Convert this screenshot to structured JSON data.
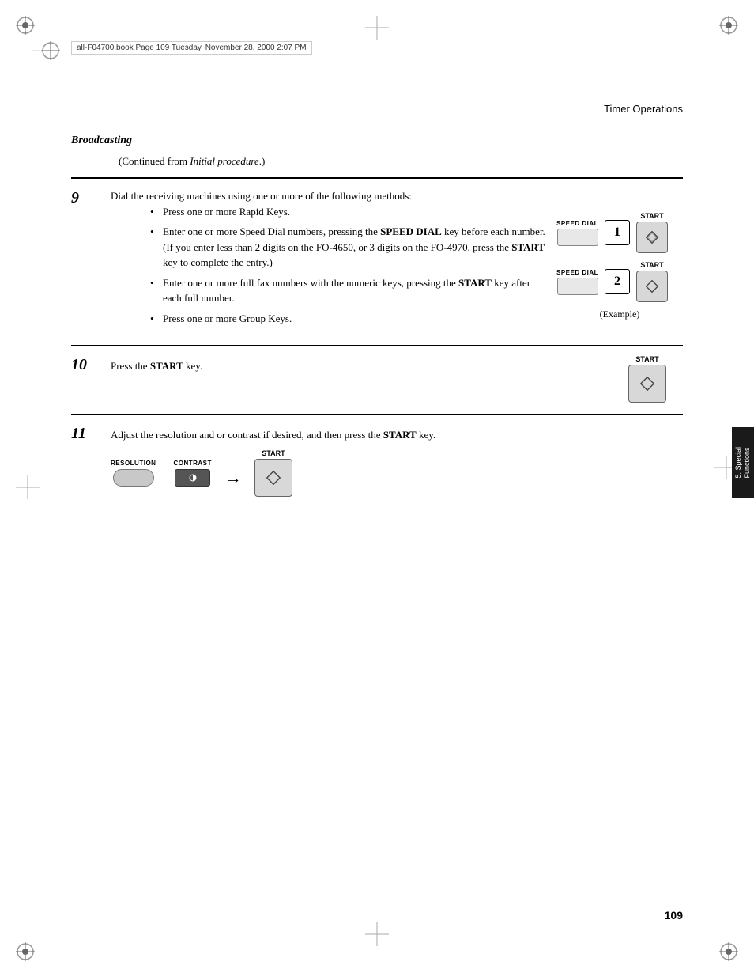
{
  "page": {
    "title": "Timer Operations",
    "page_number": "109",
    "file_header": "all-F04700.book  Page 109  Tuesday, November 28, 2000  2:07 PM"
  },
  "section": {
    "heading": "Broadcasting",
    "continued_text": "(Continued from ",
    "continued_italic": "Initial procedure",
    "continued_end": ".)"
  },
  "steps": {
    "step9": {
      "number": "9",
      "text": "Dial the receiving machines using one or more of the following methods:",
      "bullets": [
        "Press one or more Rapid Keys.",
        "Enter one or more Speed Dial numbers, pressing the SPEED DIAL key before each number. (If you enter less than 2 digits on the FO-4650, or 3 digits on the FO-4970, press the START key to complete the entry.)",
        "Enter one or more full fax numbers with the numeric keys, pressing the START key after each full number.",
        "Press one or more Group Keys."
      ],
      "diagram": {
        "speed_dial_label": "SPEED DIAL",
        "number1": "1",
        "number2": "2",
        "start_label": "START",
        "example_text": "(Example)"
      }
    },
    "step10": {
      "number": "10",
      "text_prefix": "Press the ",
      "text_bold": "START",
      "text_suffix": " key.",
      "diagram": {
        "start_label": "START"
      }
    },
    "step11": {
      "number": "11",
      "text_prefix": "Adjust the resolution and or contrast if desired, and then press the ",
      "text_bold": "START",
      "text_suffix": " key.",
      "diagram": {
        "resolution_label": "RESOLUTION",
        "contrast_label": "CONTRAST",
        "start_label": "START"
      }
    }
  },
  "side_tab": {
    "line1": "5. Special",
    "line2": "Functions"
  }
}
